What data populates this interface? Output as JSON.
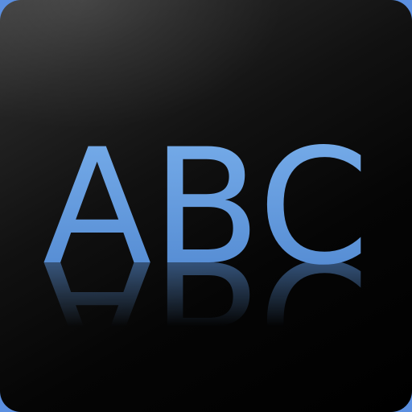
{
  "icon": {
    "text": "ABC",
    "text_color_top": "#7ab0ec",
    "text_color_bottom": "#4f86cf",
    "tile_color": "#000000",
    "edge_color": "#5b8fe0",
    "reflection": true
  }
}
